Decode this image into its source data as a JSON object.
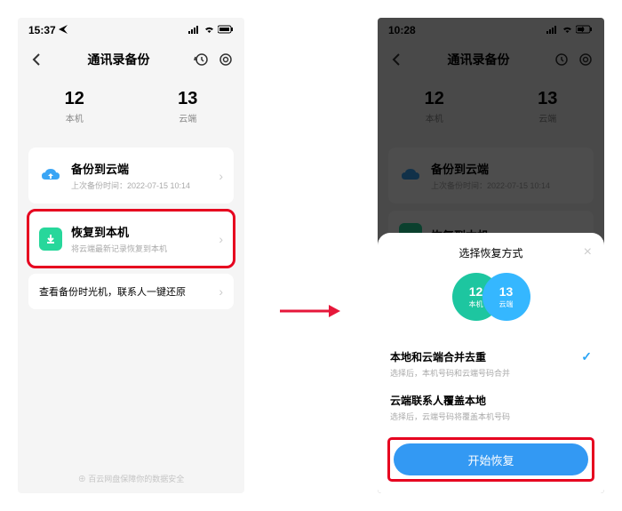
{
  "left": {
    "status": {
      "time": "15:37",
      "loc_icon": "location-arrow",
      "signal": "signal",
      "wifi": "wifi",
      "battery": "battery"
    },
    "header": {
      "title": "通讯录备份"
    },
    "stats": {
      "local_num": "12",
      "local_label": "本机",
      "cloud_num": "13",
      "cloud_label": "云端"
    },
    "backup": {
      "title": "备份到云端",
      "sub": "上次备份时间：2022-07-15 10:14"
    },
    "restore": {
      "title": "恢复到本机",
      "sub": "将云端最新记录恢复到本机"
    },
    "time_machine": {
      "title": "查看备份时光机，联系人一键还原"
    },
    "footer": "百云网盘保障你的数据安全"
  },
  "right": {
    "status": {
      "time": "10:28"
    },
    "header": {
      "title": "通讯录备份"
    },
    "stats": {
      "local_num": "12",
      "local_label": "本机",
      "cloud_num": "13",
      "cloud_label": "云端"
    },
    "backup": {
      "title": "备份到云端",
      "sub": "上次备份时间：2022-07-15 10:14"
    },
    "restore": {
      "title": "恢复到本机"
    },
    "sheet": {
      "title": "选择恢复方式",
      "circle_left_num": "12",
      "circle_left_label": "本机",
      "circle_right_num": "13",
      "circle_right_label": "云端",
      "opt1_title": "本地和云端合并去重",
      "opt1_sub": "选择后，本机号码和云端号码合并",
      "opt2_title": "云端联系人覆盖本地",
      "opt2_sub": "选择后，云端号码将覆盖本机号码",
      "start_label": "开始恢复"
    }
  }
}
